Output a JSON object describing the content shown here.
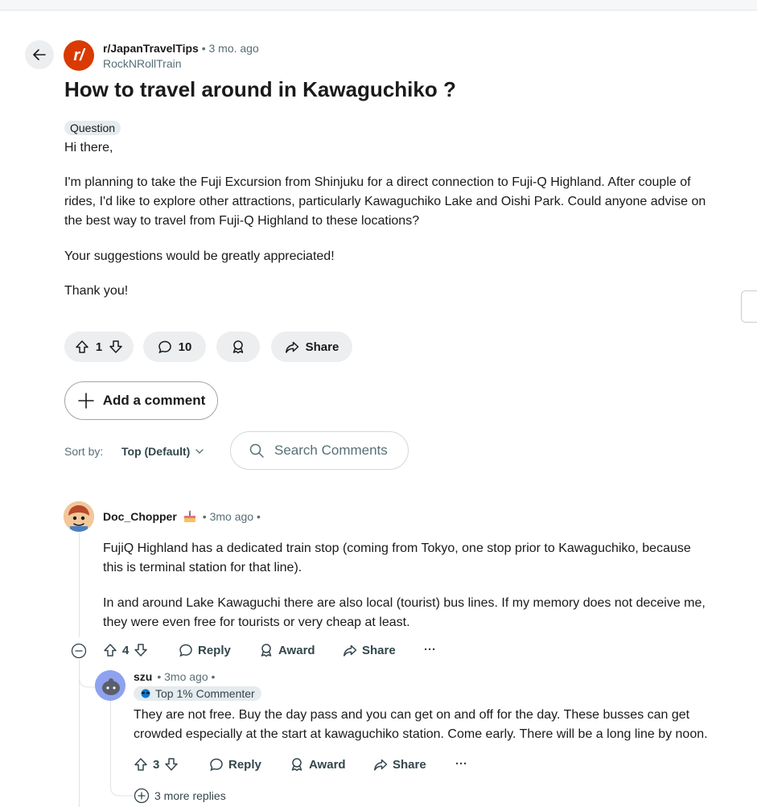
{
  "post": {
    "subreddit": "r/JapanTravelTips",
    "time": "• 3 mo. ago",
    "author": "RockNRollTrain",
    "avatar_text": "r/",
    "title": "How to travel around in Kawaguchiko ?",
    "flair": "Question",
    "body": {
      "p1": "Hi there,",
      "p2_l1": "I'm planning to take the Fuji Excursion from Shinjuku for a direct connection to Fuji-Q Highland. After couple of",
      "p2_l2": "rides, I'd like to explore other attractions, particularly Kawaguchiko Lake and Oishi Park. Could anyone advise on",
      "p2_l3": "the best way to travel from Fuji-Q Highland to these locations?",
      "p3": "Your suggestions would be greatly appreciated!",
      "p4": "Thank you!"
    },
    "votes": "1",
    "comments": "10",
    "share_label": "Share"
  },
  "add_comment_label": "Add a comment",
  "sort": {
    "label": "Sort by:",
    "value": "Top (Default)"
  },
  "search": {
    "placeholder": "Search Comments"
  },
  "comments": [
    {
      "user": "Doc_Chopper",
      "meta": "• 3mo ago •",
      "p1_l1": "FujiQ Highland has a dedicated train stop (coming from Tokyo, one stop prior to Kawaguchiko, because",
      "p1_l2": "this is terminal station for that line).",
      "p2_l1": "In and around Lake Kawaguchi there are also local (tourist) bus lines. If my memory does not deceive me,",
      "p2_l2": "they were even free for tourists or very cheap at least.",
      "votes": "4",
      "reply": "Reply",
      "award": "Award",
      "share": "Share",
      "more": "···"
    },
    {
      "user": "szu",
      "meta": "• 3mo ago •",
      "flair": "Top 1% Commenter",
      "l1": "They are not free. Buy the day pass and you can get on and off for the day. These busses can get",
      "l2": "crowded especially at the start at kawaguchiko station. Come early. There will be a long line by noon.",
      "votes": "3",
      "reply": "Reply",
      "award": "Award",
      "share": "Share",
      "more": "···",
      "more_replies": "3 more replies"
    }
  ]
}
